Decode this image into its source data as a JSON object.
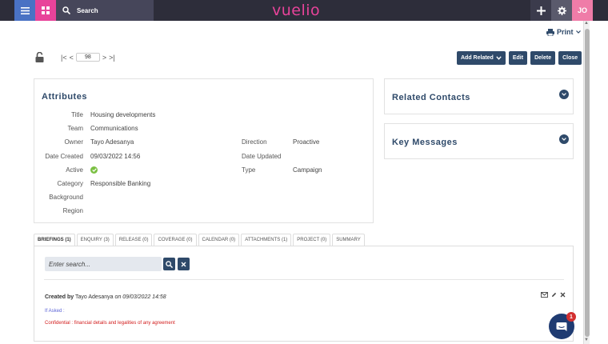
{
  "topbar": {
    "search_label": "Search",
    "logo": "vuelio",
    "user_initials": "JO"
  },
  "print_label": "Print",
  "record_nav": {
    "index": "98"
  },
  "actions": {
    "add_related": "Add Related",
    "edit": "Edit",
    "delete": "Delete",
    "close": "Close"
  },
  "attributes": {
    "title": "Attributes",
    "left": [
      {
        "label": "Title",
        "value": "Housing developments"
      },
      {
        "label": "Team",
        "value": "Communications"
      },
      {
        "label": "Owner",
        "value": "Tayo Adesanya"
      },
      {
        "label": "Date Created",
        "value": "09/03/2022 14:56"
      },
      {
        "label": "Active",
        "value": ""
      },
      {
        "label": "Category",
        "value": "Responsible Banking"
      },
      {
        "label": "Background",
        "value": ""
      },
      {
        "label": "Region",
        "value": ""
      }
    ],
    "right": [
      {
        "label": "Direction",
        "value": "Proactive"
      },
      {
        "label": "Date Updated",
        "value": ""
      },
      {
        "label": "Type",
        "value": "Campaign"
      }
    ]
  },
  "related_contacts": {
    "title": "Related Contacts"
  },
  "key_messages": {
    "title": "Key Messages"
  },
  "tabs": [
    {
      "label": "BRIEFINGS (1)",
      "active": true
    },
    {
      "label": "ENQUIRY (3)",
      "active": false
    },
    {
      "label": "RELEASE (0)",
      "active": false
    },
    {
      "label": "COVERAGE (0)",
      "active": false
    },
    {
      "label": "CALENDAR (0)",
      "active": false
    },
    {
      "label": "ATTACHMENTS (1)",
      "active": false
    },
    {
      "label": "PROJECT (0)",
      "active": false
    },
    {
      "label": "SUMMARY",
      "active": false
    }
  ],
  "briefings": {
    "search_placeholder": "Enter search...",
    "created_by_label": "Created by",
    "author": "Tayo Adesanya",
    "on_label": "on",
    "created_date": "09/03/2022 14:58",
    "if_asked": "If Asked :",
    "confidential": "Confidential : financial details and legalities of any agreement"
  },
  "chat": {
    "badge": "1"
  },
  "colors": {
    "accent": "#2f4a6a",
    "brand": "#e8439a",
    "menu": "#4a72c4",
    "active_ok": "#7bc043",
    "confidential": "#d21c1c"
  }
}
